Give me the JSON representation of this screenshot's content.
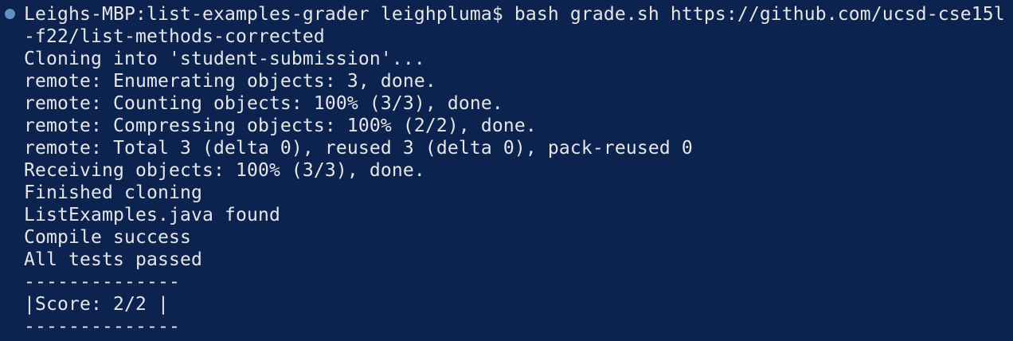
{
  "terminal": {
    "status_dot_color": "#5f93c4",
    "background_color": "#0c2350",
    "command_line_1": "Leighs-MBP:list-examples-grader leighpluma$ bash grade.sh https://github.com/ucsd-cse15l",
    "command_line_2": "-f22/list-methods-corrected",
    "output": [
      "Cloning into 'student-submission'...",
      "remote: Enumerating objects: 3, done.",
      "remote: Counting objects: 100% (3/3), done.",
      "remote: Compressing objects: 100% (2/2), done.",
      "remote: Total 3 (delta 0), reused 3 (delta 0), pack-reused 0",
      "Receiving objects: 100% (3/3), done.",
      "Finished cloning",
      "ListExamples.java found",
      "Compile success",
      "All tests passed",
      "--------------",
      "|Score: 2/2 |",
      "--------------"
    ]
  }
}
